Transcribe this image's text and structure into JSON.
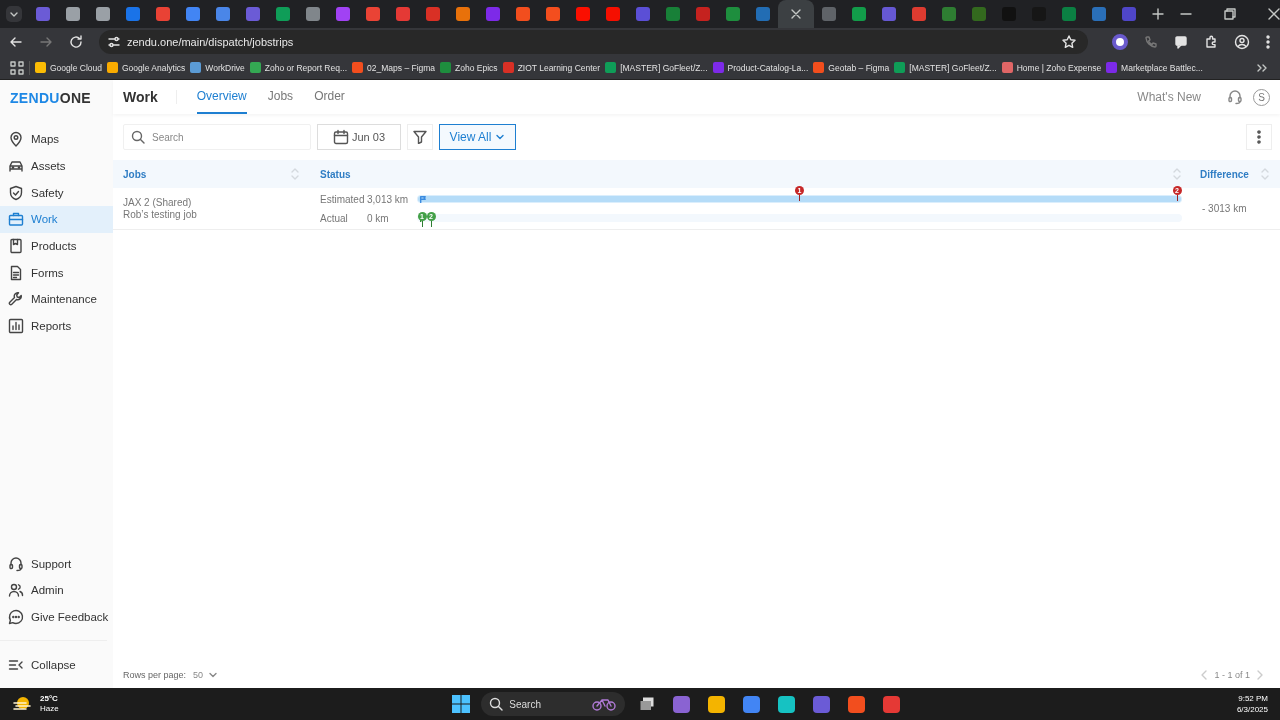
{
  "browser": {
    "tabs": [
      {
        "color": "#6b5bd6",
        "selected": false
      },
      {
        "color": "#9aa0a6",
        "selected": false
      },
      {
        "color": "#9aa0a6",
        "selected": false
      },
      {
        "color": "#1a73e8",
        "selected": false
      },
      {
        "color": "#e94235",
        "selected": false
      },
      {
        "color": "#4285f4",
        "selected": false
      },
      {
        "color": "#4a86e8",
        "selected": false
      },
      {
        "color": "#6b5bd6",
        "selected": false
      },
      {
        "color": "#0f9d58",
        "selected": false
      },
      {
        "color": "#80868b",
        "selected": false
      },
      {
        "color": "#a142f4",
        "selected": false
      },
      {
        "color": "#ea4335",
        "selected": false
      },
      {
        "color": "#e53935",
        "selected": false
      },
      {
        "color": "#d93025",
        "selected": false
      },
      {
        "color": "#e8710a",
        "selected": false
      },
      {
        "color": "#7d2ae8",
        "selected": false
      },
      {
        "color": "#f24e1e",
        "selected": false
      },
      {
        "color": "#f44e1e",
        "selected": false
      },
      {
        "color": "#fa0f00",
        "selected": false
      },
      {
        "color": "#f50f00",
        "selected": false
      },
      {
        "color": "#5b4fd6",
        "selected": false
      },
      {
        "color": "#188038",
        "selected": false
      },
      {
        "color": "#c5221f",
        "selected": false
      },
      {
        "color": "#1e8e3e",
        "selected": false
      },
      {
        "color": "#226db4",
        "selected": false
      },
      {
        "color": "#3c4043",
        "selected": true
      },
      {
        "color": "#5f6368",
        "selected": false
      },
      {
        "color": "#129c4a",
        "selected": false
      },
      {
        "color": "#6658d3",
        "selected": false
      },
      {
        "color": "#dd3b30",
        "selected": false
      },
      {
        "color": "#2e7d32",
        "selected": false
      },
      {
        "color": "#33691e",
        "selected": false
      },
      {
        "color": "#111111",
        "selected": false
      },
      {
        "color": "#161616",
        "selected": false
      },
      {
        "color": "#0b8043",
        "selected": false
      },
      {
        "color": "#2a6fb8",
        "selected": false
      },
      {
        "color": "#4f46c8",
        "selected": false
      }
    ],
    "url": "zendu.one/main/dispatch/jobstrips",
    "bookmarks": [
      {
        "label": "Google Cloud",
        "color": "#fbbc04"
      },
      {
        "label": "Google Analytics",
        "color": "#f9ab00"
      },
      {
        "label": "WorkDrive",
        "color": "#5b9bd5"
      },
      {
        "label": "Zoho or Report Req...",
        "color": "#34a853"
      },
      {
        "label": "02_Maps – Figma",
        "color": "#f24e1e"
      },
      {
        "label": "Zoho Epics",
        "color": "#1e8e3e"
      },
      {
        "label": "ZIOT Learning Center",
        "color": "#d93025"
      },
      {
        "label": "[MASTER] GoFleet/Z...",
        "color": "#0f9d58"
      },
      {
        "label": "Product-Catalog-La...",
        "color": "#7d2ae8"
      },
      {
        "label": "Geotab – Figma",
        "color": "#f24e1d"
      },
      {
        "label": "[MASTER] GoFleet/Z...",
        "color": "#0f9d57"
      },
      {
        "label": "Home | Zoho Expense",
        "color": "#e06666"
      },
      {
        "label": "Marketplace Battlec...",
        "color": "#7c2ae8"
      }
    ]
  },
  "app": {
    "logo_left": "ZENDU",
    "logo_right": "ONE",
    "section": "Work",
    "tabs": [
      {
        "label": "Overview",
        "selected": true
      },
      {
        "label": "Jobs",
        "selected": false
      },
      {
        "label": "Order",
        "selected": false
      }
    ],
    "whats_new": "What's New",
    "avatar": "S",
    "sidebar": {
      "items": [
        {
          "label": "Maps",
          "selected": false
        },
        {
          "label": "Assets",
          "selected": false
        },
        {
          "label": "Safety",
          "selected": false
        },
        {
          "label": "Work",
          "selected": true
        },
        {
          "label": "Products",
          "selected": false
        },
        {
          "label": "Forms",
          "selected": false
        },
        {
          "label": "Maintenance",
          "selected": false
        },
        {
          "label": "Reports",
          "selected": false
        }
      ],
      "bottom_items": [
        {
          "label": "Support"
        },
        {
          "label": "Admin"
        },
        {
          "label": "Give Feedback"
        }
      ],
      "collapse": "Collapse"
    },
    "toolbar": {
      "search_placeholder": "Search",
      "date": "Jun 03",
      "view": "View All"
    },
    "table": {
      "columns": [
        "Jobs",
        "Status",
        "Difference"
      ],
      "rows": [
        {
          "job": "JAX 2 (Shared)",
          "description": "Rob’s testing job",
          "estimated": {
            "label": "Estimated",
            "value": "3,013 km",
            "level": 1,
            "pins": [
              {
                "label": "1"
              },
              {
                "label": "2"
              }
            ]
          },
          "actual": {
            "label": "Actual",
            "value": "0 km",
            "level": 0,
            "pins": [
              {
                "label": "1"
              },
              {
                "label": "2"
              }
            ]
          },
          "difference": "- 3013 km"
        }
      ]
    },
    "footer": {
      "rows_per_page_label": "Rows per page:",
      "rows_per_page": "50",
      "range": "1 - 1 of 1"
    }
  },
  "taskbar": {
    "temperature": "25°C",
    "weather": "Haze",
    "search_placeholder": "Search",
    "apps": [
      {
        "color": "#8a63d2"
      },
      {
        "color": "#f4b400"
      },
      {
        "color": "#4285f4"
      },
      {
        "color": "#16c2c2"
      },
      {
        "color": "#6b5bd6"
      },
      {
        "color": "#f24e1e"
      },
      {
        "color": "#e53935"
      }
    ],
    "time": "9:52 PM",
    "date": "6/3/2025"
  }
}
